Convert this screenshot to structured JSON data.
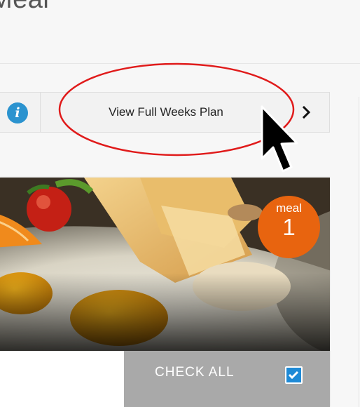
{
  "page": {
    "title": "Meal"
  },
  "toolbar": {
    "info_icon": "info-icon",
    "info_glyph": "i",
    "plan_label": "View Full Weeks Plan",
    "next_icon": "chevron-right-icon"
  },
  "annotation": {
    "highlight": "red-ellipse",
    "pointer": "mouse-cursor",
    "color": "#e01b1b"
  },
  "meal": {
    "image": "breakfast-plate-photo",
    "badge_label": "meal",
    "badge_number": "1",
    "badge_color": "#e8640f",
    "check_all_label": "CHECK ALL",
    "check_all_checked": true
  },
  "colors": {
    "info_blue": "#2b93cf",
    "checkbox_blue": "#1e8ad6",
    "check_all_bg": "#a9a9a9"
  }
}
